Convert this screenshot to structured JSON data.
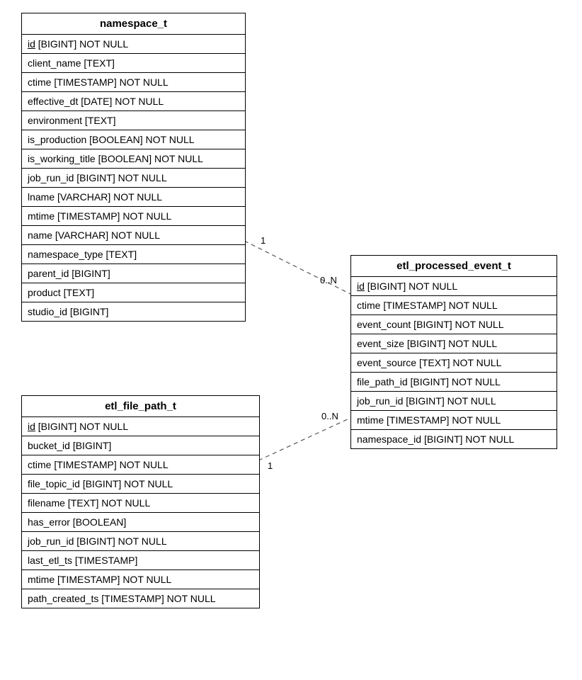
{
  "entities": {
    "namespace_t": {
      "title": "namespace_t",
      "columns": [
        {
          "name": "id",
          "type": "[BIGINT]",
          "constraint": "NOT NULL",
          "pk": true
        },
        {
          "name": "client_name",
          "type": "[TEXT]",
          "constraint": ""
        },
        {
          "name": "ctime",
          "type": "[TIMESTAMP]",
          "constraint": "NOT NULL"
        },
        {
          "name": "effective_dt",
          "type": "[DATE]",
          "constraint": "NOT NULL"
        },
        {
          "name": "environment",
          "type": "[TEXT]",
          "constraint": ""
        },
        {
          "name": "is_production",
          "type": "[BOOLEAN]",
          "constraint": "NOT NULL"
        },
        {
          "name": "is_working_title",
          "type": "[BOOLEAN]",
          "constraint": "NOT NULL"
        },
        {
          "name": "job_run_id",
          "type": "[BIGINT]",
          "constraint": "NOT NULL"
        },
        {
          "name": "lname",
          "type": "[VARCHAR]",
          "constraint": "NOT NULL"
        },
        {
          "name": "mtime",
          "type": "[TIMESTAMP]",
          "constraint": "NOT NULL"
        },
        {
          "name": "name",
          "type": "[VARCHAR]",
          "constraint": "NOT NULL"
        },
        {
          "name": "namespace_type",
          "type": "[TEXT]",
          "constraint": ""
        },
        {
          "name": "parent_id",
          "type": "[BIGINT]",
          "constraint": ""
        },
        {
          "name": "product",
          "type": "[TEXT]",
          "constraint": ""
        },
        {
          "name": "studio_id",
          "type": "[BIGINT]",
          "constraint": ""
        }
      ]
    },
    "etl_processed_event_t": {
      "title": "etl_processed_event_t",
      "columns": [
        {
          "name": "id",
          "type": "[BIGINT]",
          "constraint": "NOT NULL",
          "pk": true
        },
        {
          "name": "ctime",
          "type": "[TIMESTAMP]",
          "constraint": "NOT NULL"
        },
        {
          "name": "event_count",
          "type": "[BIGINT]",
          "constraint": "NOT NULL"
        },
        {
          "name": "event_size",
          "type": "[BIGINT]",
          "constraint": "NOT NULL"
        },
        {
          "name": "event_source",
          "type": "[TEXT]",
          "constraint": "NOT NULL"
        },
        {
          "name": "file_path_id",
          "type": "[BIGINT]",
          "constraint": "NOT NULL"
        },
        {
          "name": "job_run_id",
          "type": "[BIGINT]",
          "constraint": "NOT NULL"
        },
        {
          "name": "mtime",
          "type": "[TIMESTAMP]",
          "constraint": "NOT NULL"
        },
        {
          "name": "namespace_id",
          "type": "[BIGINT]",
          "constraint": "NOT NULL"
        }
      ]
    },
    "etl_file_path_t": {
      "title": "etl_file_path_t",
      "columns": [
        {
          "name": "id",
          "type": "[BIGINT]",
          "constraint": "NOT NULL",
          "pk": true
        },
        {
          "name": "bucket_id",
          "type": "[BIGINT]",
          "constraint": ""
        },
        {
          "name": "ctime",
          "type": "[TIMESTAMP]",
          "constraint": "NOT NULL"
        },
        {
          "name": "file_topic_id",
          "type": "[BIGINT]",
          "constraint": "NOT NULL"
        },
        {
          "name": "filename",
          "type": "[TEXT]",
          "constraint": "NOT NULL"
        },
        {
          "name": "has_error",
          "type": "[BOOLEAN]",
          "constraint": ""
        },
        {
          "name": "job_run_id",
          "type": "[BIGINT]",
          "constraint": "NOT NULL"
        },
        {
          "name": "last_etl_ts",
          "type": "[TIMESTAMP]",
          "constraint": ""
        },
        {
          "name": "mtime",
          "type": "[TIMESTAMP]",
          "constraint": "NOT NULL"
        },
        {
          "name": "path_created_ts",
          "type": "[TIMESTAMP]",
          "constraint": "NOT NULL"
        }
      ]
    }
  },
  "relationships": {
    "namespace_to_event": {
      "from_label": "1",
      "to_label": "0..N"
    },
    "filepath_to_event": {
      "from_label": "1",
      "to_label": "0..N"
    }
  }
}
